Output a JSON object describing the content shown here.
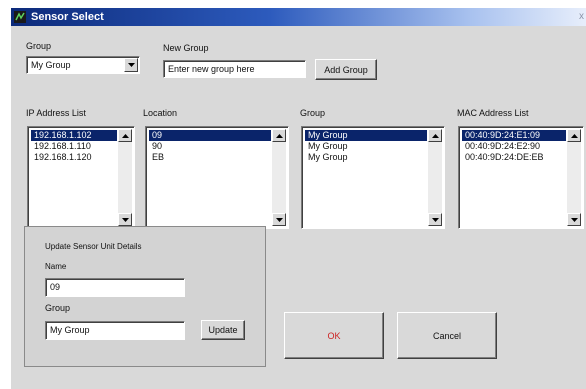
{
  "window": {
    "title": "Sensor Select",
    "close": "x"
  },
  "top": {
    "group_label": "Group",
    "group_value": "My Group",
    "new_group_label": "New Group",
    "new_group_value": "Enter new group here",
    "add_group_button": "Add Group"
  },
  "lists": {
    "ip": {
      "header": "IP Address List",
      "items": [
        "192.168.1.102",
        "192.168.1.110",
        "192.168.1.120"
      ]
    },
    "location": {
      "header": "Location",
      "items": [
        "09",
        "90",
        "EB"
      ]
    },
    "group": {
      "header": "Group",
      "items": [
        "My Group",
        "My Group",
        "My Group"
      ]
    },
    "mac": {
      "header": "MAC Address List",
      "items": [
        "00:40:9D:24:E1:09",
        "00:40:9D:24:E2:90",
        "00:40:9D:24:DE:EB"
      ]
    }
  },
  "details": {
    "heading": "Update Sensor Unit Details",
    "name_label": "Name",
    "name_value": "09",
    "group_label": "Group",
    "group_value": "My Group",
    "update_button": "Update"
  },
  "buttons": {
    "ok": "OK",
    "cancel": "Cancel"
  },
  "colors": {
    "selection": "#0a246a",
    "ok_text": "#cc2222",
    "title_start": "#0c2a7a"
  }
}
